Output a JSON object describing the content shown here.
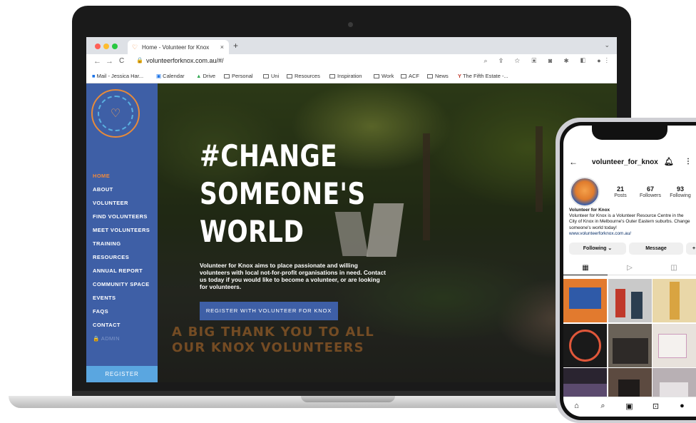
{
  "browser": {
    "tab_title": "Home - Volunteer for Knox",
    "tab_close": "×",
    "new_tab": "+",
    "chevron": "⌄",
    "url": "volunteerforknox.com.au/#/",
    "nav": {
      "back": "←",
      "forward": "→",
      "reload": "C"
    },
    "traffic_lights": [
      "#ff5f57",
      "#febc2e",
      "#28c840"
    ],
    "bookmarks": [
      "Mail - Jessica Har...",
      "Calendar",
      "Drive",
      "Personal",
      "Uni",
      "Resources",
      "Inspiration",
      "Work",
      "ACF",
      "News",
      "The Fifth Estate -..."
    ]
  },
  "site": {
    "brand_colors": {
      "sidebar": "#3e5fa6",
      "accent": "#f08a3c",
      "register": "#5aa6e0"
    },
    "nav": [
      {
        "label": "HOME",
        "active": true
      },
      {
        "label": "ABOUT"
      },
      {
        "label": "VOLUNTEER"
      },
      {
        "label": "FIND VOLUNTEERS"
      },
      {
        "label": "MEET VOLUNTEERS"
      },
      {
        "label": "TRAINING"
      },
      {
        "label": "RESOURCES"
      },
      {
        "label": "ANNUAL REPORT"
      },
      {
        "label": "COMMUNITY SPACE"
      },
      {
        "label": "EVENTS"
      },
      {
        "label": "FAQS"
      },
      {
        "label": "CONTACT"
      },
      {
        "label": "🔒 ADMIN",
        "muted": true
      }
    ],
    "register_label": "REGISTER",
    "hero": {
      "title_lines": [
        "#CHANGE",
        "SOMEONE'S",
        "WORLD"
      ],
      "text": "Volunteer for Knox aims to place passionate and willing volunteers with local not-for-profit organisations in need. Contact us today if you would like to become a volunteer, or are looking for volunteers.",
      "button": "REGISTER WITH VOLUNTEER FOR KNOX",
      "thanks_lines": [
        "A BIG THANK YOU TO ALL",
        "OUR KNOX VOLUNTEERS"
      ]
    }
  },
  "instagram": {
    "username": "volunteer_for_knox",
    "stats": [
      {
        "value": "21",
        "label": "Posts"
      },
      {
        "value": "67",
        "label": "Followers"
      },
      {
        "value": "93",
        "label": "Following"
      }
    ],
    "bio_name": "Volunteer for Knox",
    "bio_text": "Volunteer for Knox is a Volunteer Resource Centre in the City of Knox in Melbourne's Outer Eastern suburbs. Change someone's world today!",
    "bio_link": "www.volunteerforknox.com.au/",
    "following_label": "Following ⌄",
    "message_label": "Message",
    "add_person": "+",
    "post_colors": [
      "#e27a2e",
      "#c9c9c9",
      "#e9d7a8",
      "#1a1a1a",
      "#6a6258",
      "#e8e2dc",
      "#2a2430",
      "#5c4a40",
      "#b8b0b4"
    ]
  }
}
